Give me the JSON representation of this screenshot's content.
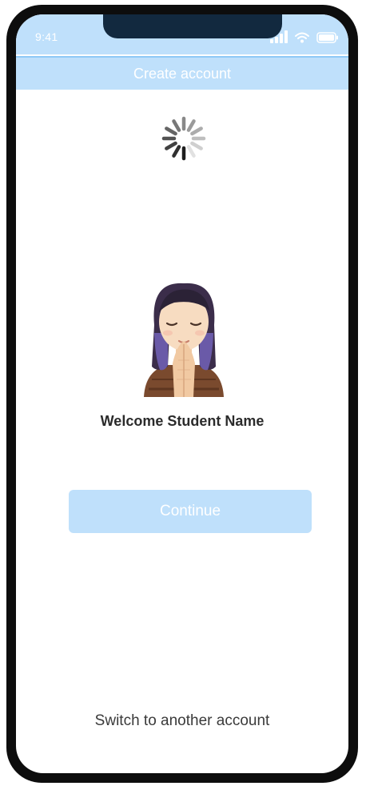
{
  "status_bar": {
    "time": "9:41",
    "icons": [
      "signal-icon",
      "wifi-icon",
      "battery-icon"
    ]
  },
  "header": {
    "title": "Create account"
  },
  "loading": {
    "icon": "spinner-icon"
  },
  "avatar": {
    "icon": "praying-person-memoji"
  },
  "welcome": {
    "text": "Welcome Student Name"
  },
  "actions": {
    "continue_label": "Continue",
    "switch_account_label": "Switch to another account"
  },
  "colors": {
    "accent_light": "#bfe0fb",
    "accent_border": "#8ec9f6",
    "notch": "#12293f",
    "frame": "#0d0d0d",
    "text": "#2b2b2b"
  }
}
